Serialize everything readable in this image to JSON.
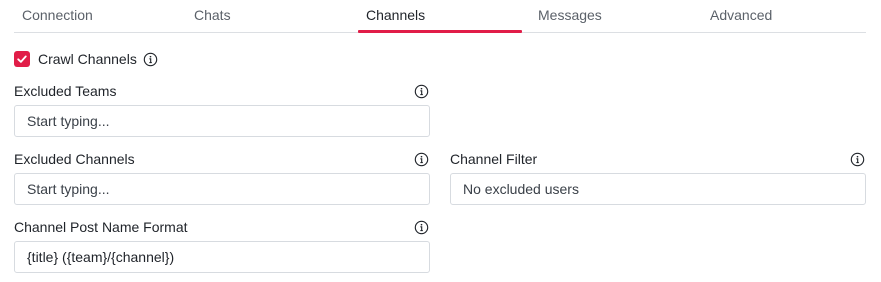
{
  "tabs": [
    {
      "label": "Connection",
      "active": false
    },
    {
      "label": "Chats",
      "active": false
    },
    {
      "label": "Channels",
      "active": true
    },
    {
      "label": "Messages",
      "active": false
    },
    {
      "label": "Advanced",
      "active": false
    }
  ],
  "accent_color": "#e11d48",
  "crawl_channels": {
    "label": "Crawl Channels",
    "checked": true,
    "icon": "info-icon"
  },
  "excluded_teams": {
    "label": "Excluded Teams",
    "placeholder": "Start typing...",
    "icon": "info-icon"
  },
  "excluded_channels": {
    "label": "Excluded Channels",
    "placeholder": "Start typing...",
    "icon": "info-icon"
  },
  "channel_filter": {
    "label": "Channel Filter",
    "placeholder": "No excluded users",
    "icon": "info-icon"
  },
  "channel_post_name_format": {
    "label": "Channel Post Name Format",
    "value": "{title} ({team}/{channel})",
    "icon": "info-icon"
  }
}
